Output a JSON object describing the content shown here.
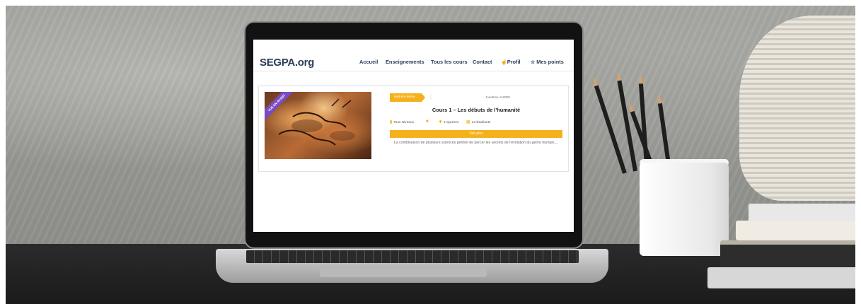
{
  "site": {
    "logo": "SEGPA.org",
    "nav": [
      {
        "label": "Accueil",
        "icon": ""
      },
      {
        "label": "Enseignements",
        "icon": ""
      },
      {
        "label": "Tous les cours",
        "icon": ""
      },
      {
        "label": "Contact",
        "icon": ""
      },
      {
        "label": "Profil",
        "icon": "pointing-hand-icon"
      },
      {
        "label": "Mes points",
        "icon": "star-icon"
      }
    ]
  },
  "course": {
    "ribbon": "VUE EN AVANT",
    "category": "Histoire 6ème",
    "author": "Jonathan ANDRÉ",
    "title": "Cours 1 – Les débuts de l'humanité",
    "level": "Tous Niveaux",
    "quizzes": "4 Quizzes",
    "students": "13 Étudiants",
    "button": "Voir plus",
    "description": "La combinaison de plusieurs sciences permet de percer les secrets de l'évolution du genre humain,..."
  },
  "colors": {
    "accent": "#f5b11b",
    "brand": "#2c3e58",
    "ribbon": "#7b4bc4"
  }
}
